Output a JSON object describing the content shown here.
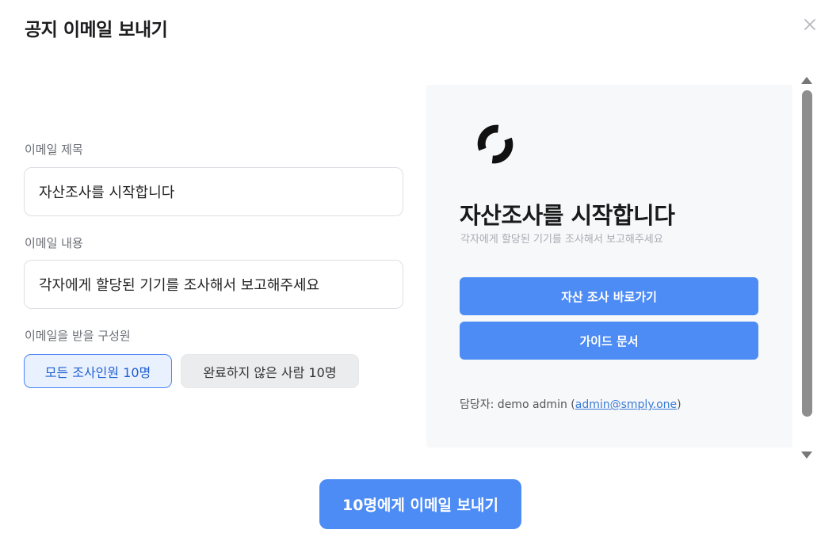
{
  "dialog": {
    "title": "공지 이메일 보내기",
    "close_icon": "close-icon"
  },
  "form": {
    "subject_label": "이메일 제목",
    "subject_value": "자산조사를 시작합니다",
    "body_label": "이메일 내용",
    "body_value": "각자에게 할당된 기기를 조사해서 보고해주세요",
    "recipients_label": "이메일을 받을 구성원",
    "recipient_options": [
      {
        "label": "모든 조사인원 10명",
        "selected": true
      },
      {
        "label": "완료하지 않은 사람 10명",
        "selected": false
      }
    ]
  },
  "preview": {
    "logo_icon": "brand-logo-icon",
    "title": "자산조사를 시작합니다",
    "subtitle": "각자에게 할당된 기기를 조사해서 보고해주세요",
    "primary_button": "자산 조사 바로가기",
    "secondary_button": "가이드 문서",
    "contact_prefix": "담당자: demo admin (",
    "contact_email": "admin@smply.one",
    "contact_suffix": ")"
  },
  "send_button": "10명에게 이메일 보내기",
  "colors": {
    "accent": "#4e8cf5",
    "selected_chip_bg": "#e9f1ff",
    "selected_chip_text": "#1f5fd1",
    "preview_bg": "#f7f8fa"
  }
}
